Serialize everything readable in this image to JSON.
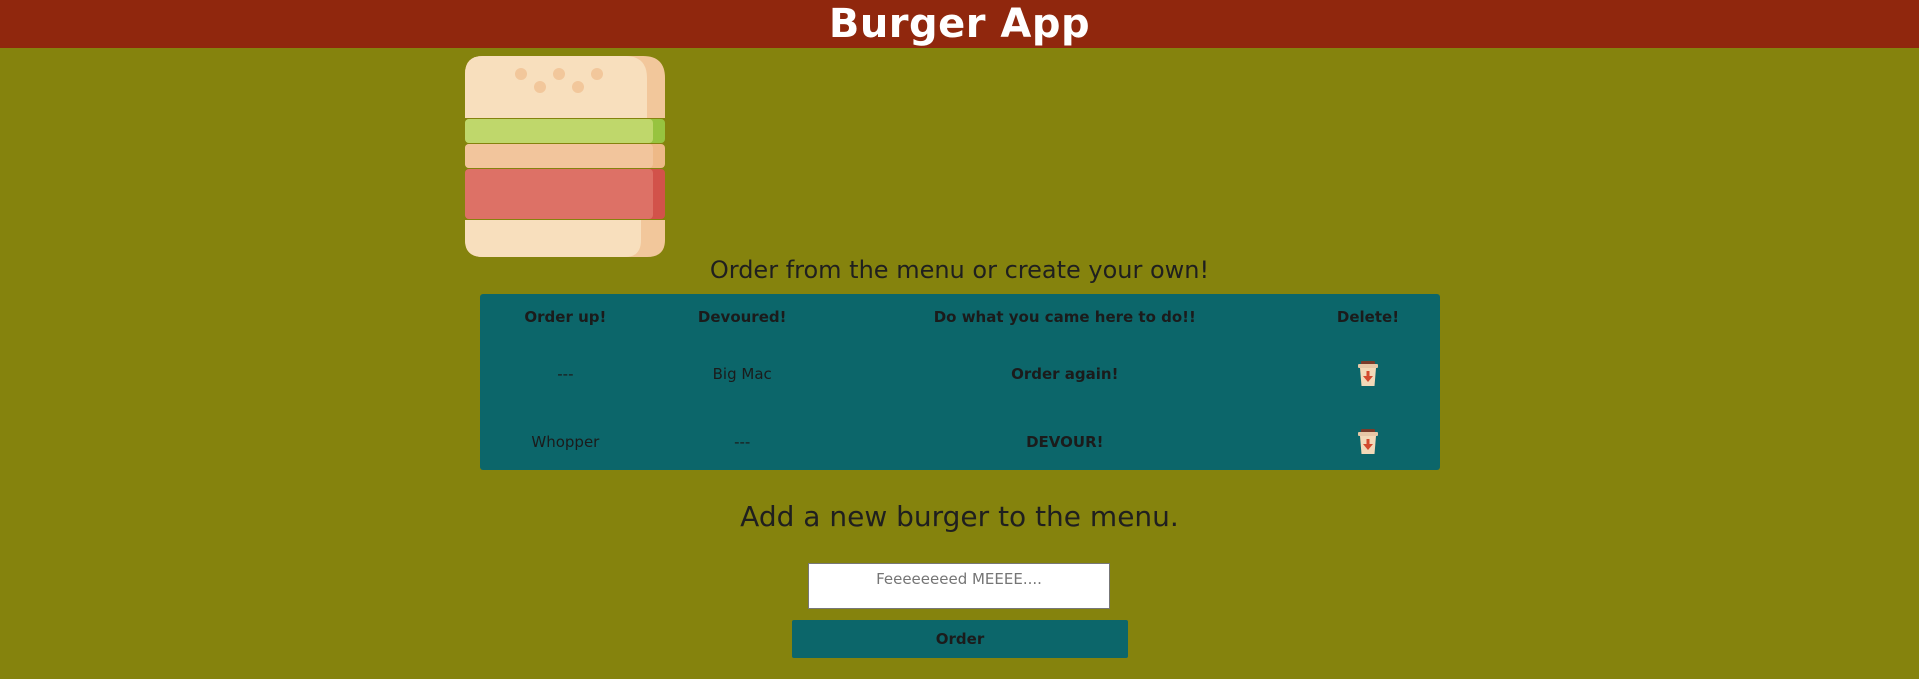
{
  "header": {
    "title": "Burger App"
  },
  "menu": {
    "title": "Order from the menu or create your own!",
    "columns": [
      "Order up!",
      "Devoured!",
      "Do what you came here to do!!",
      "Delete!"
    ],
    "rows": [
      {
        "order_up": "---",
        "devoured": "Big Mac",
        "action": "Order again!"
      },
      {
        "order_up": "Whopper",
        "devoured": "---",
        "action": "DEVOUR!"
      }
    ]
  },
  "add": {
    "title": "Add a new burger to the menu.",
    "input_placeholder": "Feeeeeeeed MEEEE....",
    "order_label": "Order"
  },
  "icons": {
    "logo": "burger-icon",
    "delete": "trash-icon"
  },
  "colors": {
    "background": "#85830d",
    "header": "#90270d",
    "table": "#0c666a"
  }
}
